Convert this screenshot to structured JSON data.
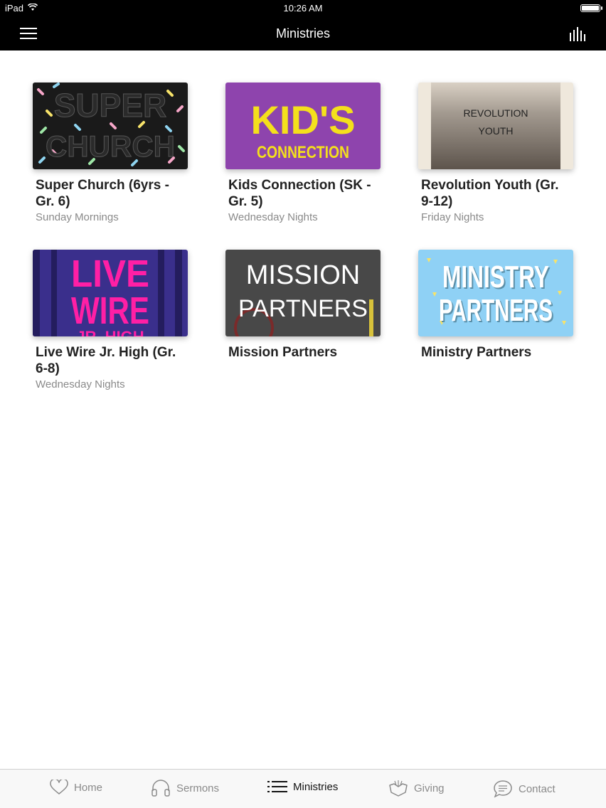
{
  "status_bar": {
    "device": "iPad",
    "time": "10:26 AM",
    "battery_level": 1.0
  },
  "nav": {
    "title": "Ministries",
    "menu_icon": "hamburger-menu-icon",
    "right_icon": "equalizer-bars-icon"
  },
  "ministries": [
    {
      "title": "Super Church (6yrs - Gr. 6)",
      "subtitle": "Sunday Mornings",
      "image_text": [
        "SUPER",
        "CHURCH"
      ],
      "image_colors": [
        "#1a1a1a",
        "#f6a6c8",
        "#8fd4f0",
        "#f7e36a"
      ]
    },
    {
      "title": "Kids Connection (SK - Gr. 5)",
      "subtitle": "Wednesday Nights",
      "image_text": [
        "KID'S",
        "CONNECTION"
      ],
      "image_colors": [
        "#8e44ad",
        "#f4e01c"
      ]
    },
    {
      "title": "Revolution Youth (Gr. 9-12)",
      "subtitle": "Friday Nights",
      "image_text": [
        "REVOLUTION",
        "YOUTH"
      ],
      "image_colors": [
        "#efe8dc",
        "#6e655c"
      ]
    },
    {
      "title": "Live Wire Jr. High (Gr. 6-8)",
      "subtitle": "Wednesday Nights",
      "image_text": [
        "LIVE",
        "WIRE",
        "JR. HIGH"
      ],
      "image_colors": [
        "#3a2f8c",
        "#ff1fa5"
      ]
    },
    {
      "title": "Mission Partners",
      "subtitle": "",
      "image_text": [
        "MISSION",
        "PARTNERS"
      ],
      "image_colors": [
        "#3d3d3d",
        "#ffffff"
      ]
    },
    {
      "title": "Ministry Partners",
      "subtitle": "",
      "image_text": [
        "MINISTRY",
        "PARTNERS"
      ],
      "image_colors": [
        "#8fd1f5",
        "#ffffff"
      ]
    }
  ],
  "tabs": [
    {
      "label": "Home",
      "icon": "heart-icon",
      "active": false
    },
    {
      "label": "Sermons",
      "icon": "headphones-icon",
      "active": false
    },
    {
      "label": "Ministries",
      "icon": "list-icon",
      "active": true
    },
    {
      "label": "Giving",
      "icon": "giving-hands-icon",
      "active": false
    },
    {
      "label": "Contact",
      "icon": "chat-bubble-icon",
      "active": false
    }
  ],
  "colors": {
    "bar_background": "#000000",
    "title_text": "#222222",
    "subtitle_text": "#8a8a8a",
    "tab_inactive": "#8a8a8a",
    "tab_active": "#111111"
  }
}
